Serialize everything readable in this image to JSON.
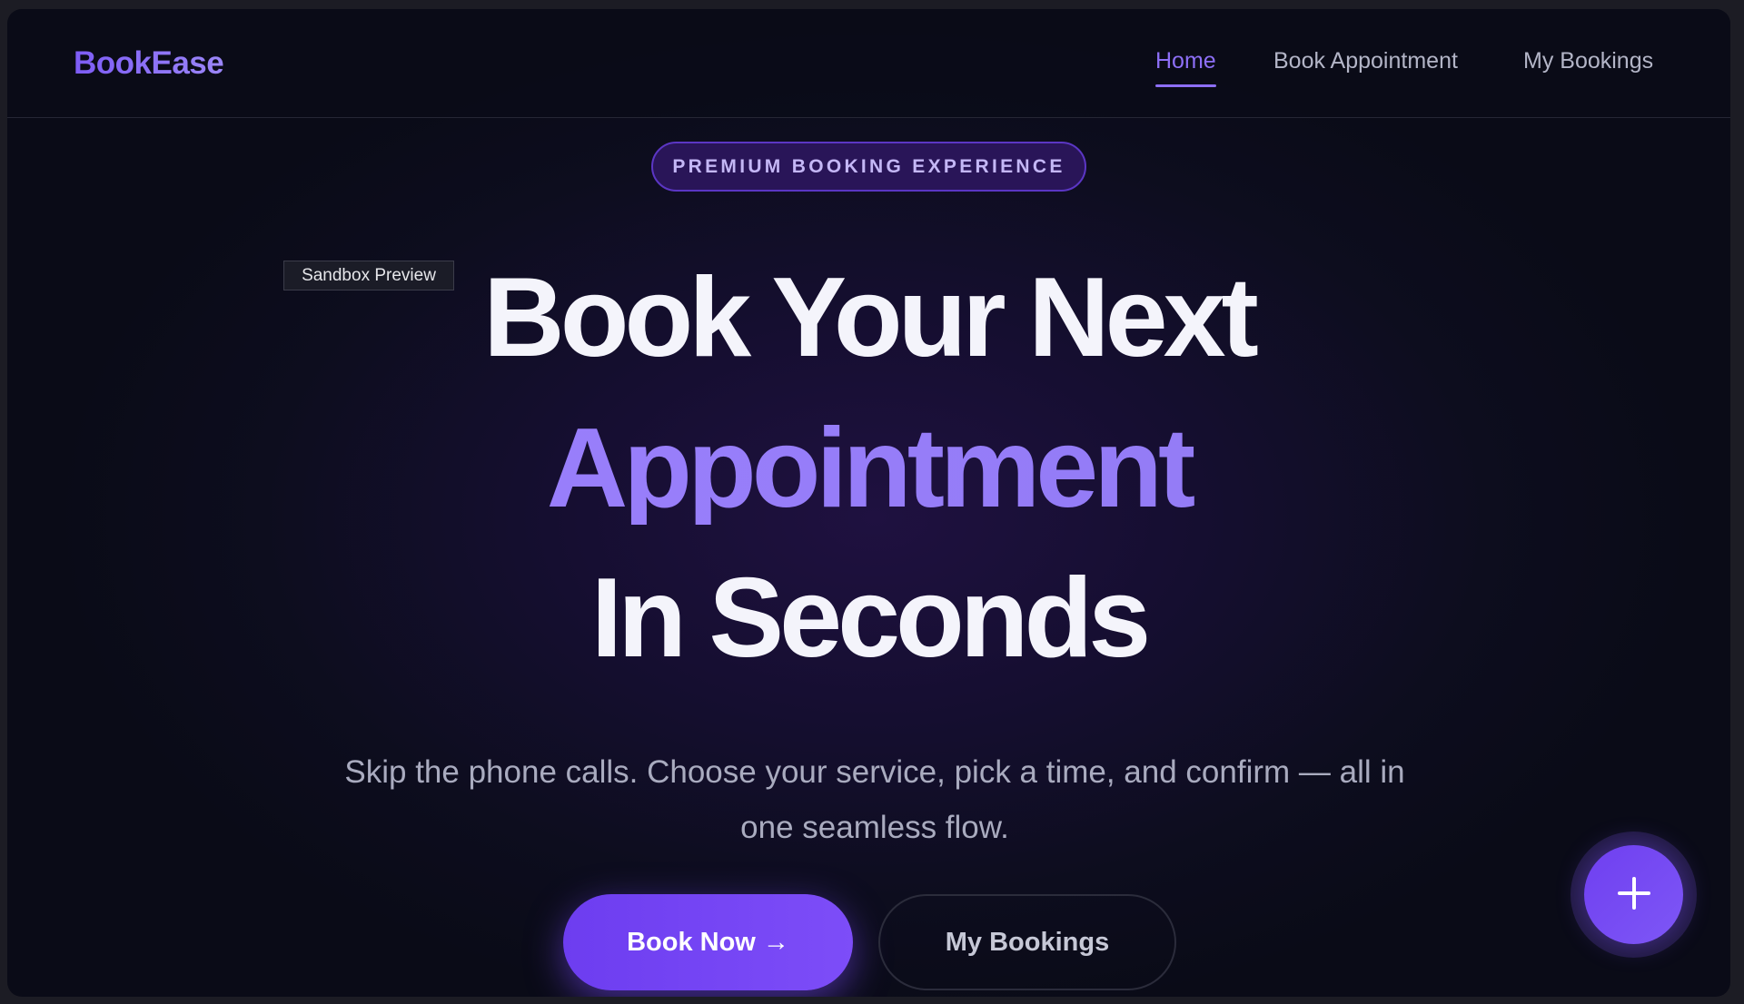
{
  "navbar": {
    "logo": "BookEase",
    "links": [
      {
        "label": "Home",
        "active": true
      },
      {
        "label": "Book Appointment",
        "active": false
      },
      {
        "label": "My Bookings",
        "active": false
      }
    ]
  },
  "hero": {
    "badge": "PREMIUM BOOKING EXPERIENCE",
    "sandbox_tag": "Sandbox Preview",
    "title_line_1": "Book Your Next",
    "title_line_2": "Appointment",
    "title_line_3": "In Seconds",
    "subtitle_line_1": "Skip the phone calls. Choose your service, pick a time, and confirm — all in",
    "subtitle_line_2": "one seamless flow.",
    "primary_button": "Book Now →",
    "secondary_button": "My Bookings"
  },
  "fab": {
    "icon": "plus-icon"
  },
  "colors": {
    "accent": "#7c4ff6",
    "accent_light": "#9d80ff",
    "background": "#0d0d1e",
    "text_primary": "#f4f4fb",
    "text_muted": "#a9abbf"
  }
}
